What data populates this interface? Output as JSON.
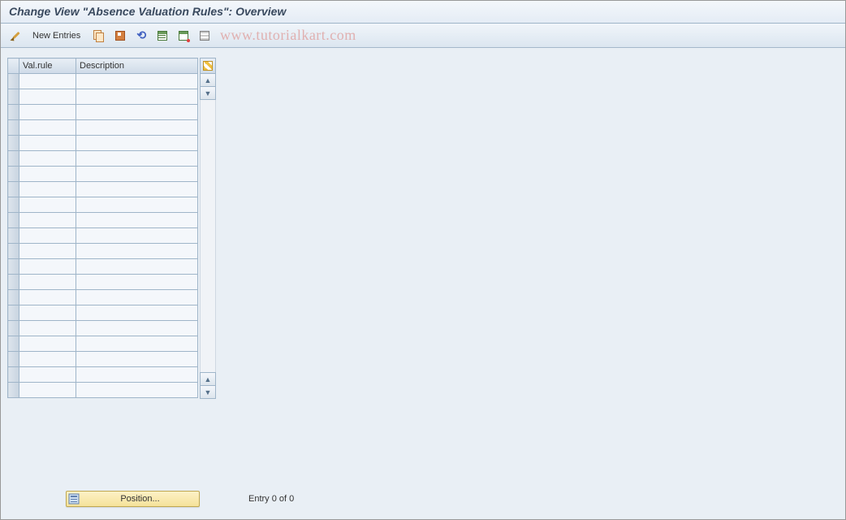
{
  "header": {
    "title": "Change View \"Absence Valuation Rules\": Overview"
  },
  "toolbar": {
    "new_entries_label": "New Entries"
  },
  "watermark": "www.tutorialkart.com",
  "table": {
    "columns": {
      "val_rule": "Val.rule",
      "description": "Description"
    },
    "row_count": 21
  },
  "footer": {
    "position_label": "Position...",
    "entry_text": "Entry 0 of 0"
  }
}
